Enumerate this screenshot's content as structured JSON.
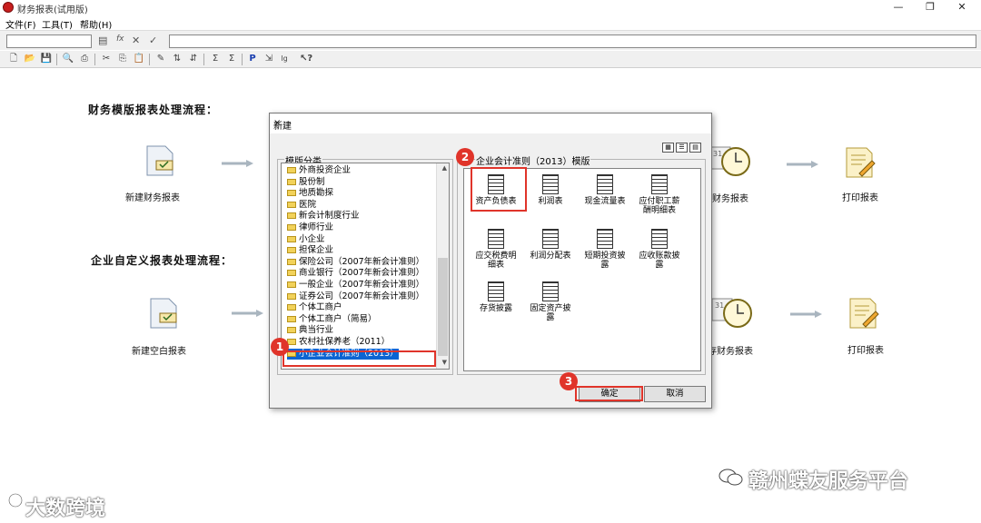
{
  "window": {
    "title": "财务报表(试用版)",
    "minimize": "—",
    "maximize": "❐",
    "close": "✕"
  },
  "menu": [
    "文件(F)",
    "工具(T)",
    "帮助(H)"
  ],
  "flows": {
    "template_title": "财务模版报表处理流程：",
    "custom_title": "企业自定义报表处理流程：",
    "new_financial_report": "新建财务报表",
    "new_blank_report": "新建空白报表",
    "save_financial_report_partial_1": "财务报表",
    "save_financial_report_partial_2": "存财务报表",
    "print_report_1": "打印报表",
    "print_report_2": "打印报表"
  },
  "dialog": {
    "title": "新建",
    "close": "×",
    "category_group": "模版分类",
    "template_group": "企业会计准则（2013）模版",
    "categories": [
      "外商投资企业",
      "股份制",
      "地质勘探",
      "医院",
      "新会计制度行业",
      "律师行业",
      "小企业",
      "担保企业",
      "保险公司（2007年新会计准则）",
      "商业银行（2007年新会计准则）",
      "一般企业（2007年新会计准则）",
      "证券公司（2007年新会计准则）",
      "个体工商户",
      "个体工商户（简易）",
      "典当行业",
      "农村社保养老（2011）",
      "小企业会计准则（2013）"
    ],
    "selected_category": "小企业会计准则（2013）",
    "templates": [
      [
        "资产负债表"
      ],
      [
        "利润表"
      ],
      [
        "现金流量表"
      ],
      [
        "应付职工薪",
        "酬明细表"
      ],
      [
        "应交税费明",
        "细表"
      ],
      [
        "利润分配表"
      ],
      [
        "短期投资披",
        "露"
      ],
      [
        "应收账款披",
        "露"
      ],
      [
        "存货披露"
      ],
      [
        "固定资产披",
        "露"
      ]
    ],
    "ok": "确定",
    "cancel": "取消"
  },
  "badges": [
    "1",
    "2",
    "3"
  ],
  "watermarks": {
    "left": "大数跨境",
    "right": "赣州蝶友服务平台"
  },
  "colors": {
    "annotation": "#e0342a",
    "selection": "#0a64d2"
  }
}
